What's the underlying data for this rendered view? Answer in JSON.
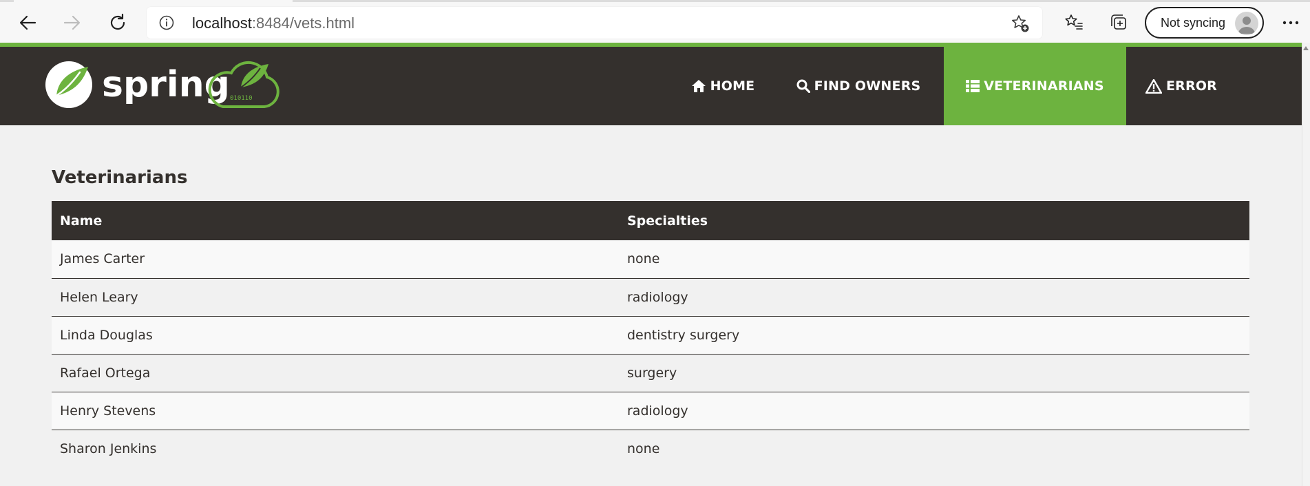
{
  "browser": {
    "url_host": "localhost",
    "url_rest": ":8484/vets.html",
    "sync_label": "Not syncing",
    "icons": {
      "back": "arrow-left-icon",
      "forward": "arrow-right-icon",
      "refresh": "refresh-icon",
      "info": "info-icon",
      "add_favorite": "star-plus-icon",
      "favorites": "favorites-list-icon",
      "collections": "collections-icon",
      "more": "more-dots-icon"
    }
  },
  "navbar": {
    "logo_text": "spring",
    "logo_badge_text": "010110",
    "items": [
      {
        "label": "HOME",
        "icon": "home-icon",
        "active": false
      },
      {
        "label": "FIND OWNERS",
        "icon": "search-icon",
        "active": false
      },
      {
        "label": "VETERINARIANS",
        "icon": "list-icon",
        "active": true
      },
      {
        "label": "ERROR",
        "icon": "warning-icon",
        "active": false
      }
    ]
  },
  "colors": {
    "brand_green": "#6db33f",
    "dark_brown": "#34302d",
    "page_bg": "#f1f1f1"
  },
  "main": {
    "title": "Veterinarians",
    "table": {
      "columns": [
        "Name",
        "Specialties"
      ],
      "rows": [
        [
          "James Carter",
          "none"
        ],
        [
          "Helen Leary",
          "radiology"
        ],
        [
          "Linda Douglas",
          "dentistry surgery"
        ],
        [
          "Rafael Ortega",
          "surgery"
        ],
        [
          "Henry Stevens",
          "radiology"
        ],
        [
          "Sharon Jenkins",
          "none"
        ]
      ]
    }
  }
}
